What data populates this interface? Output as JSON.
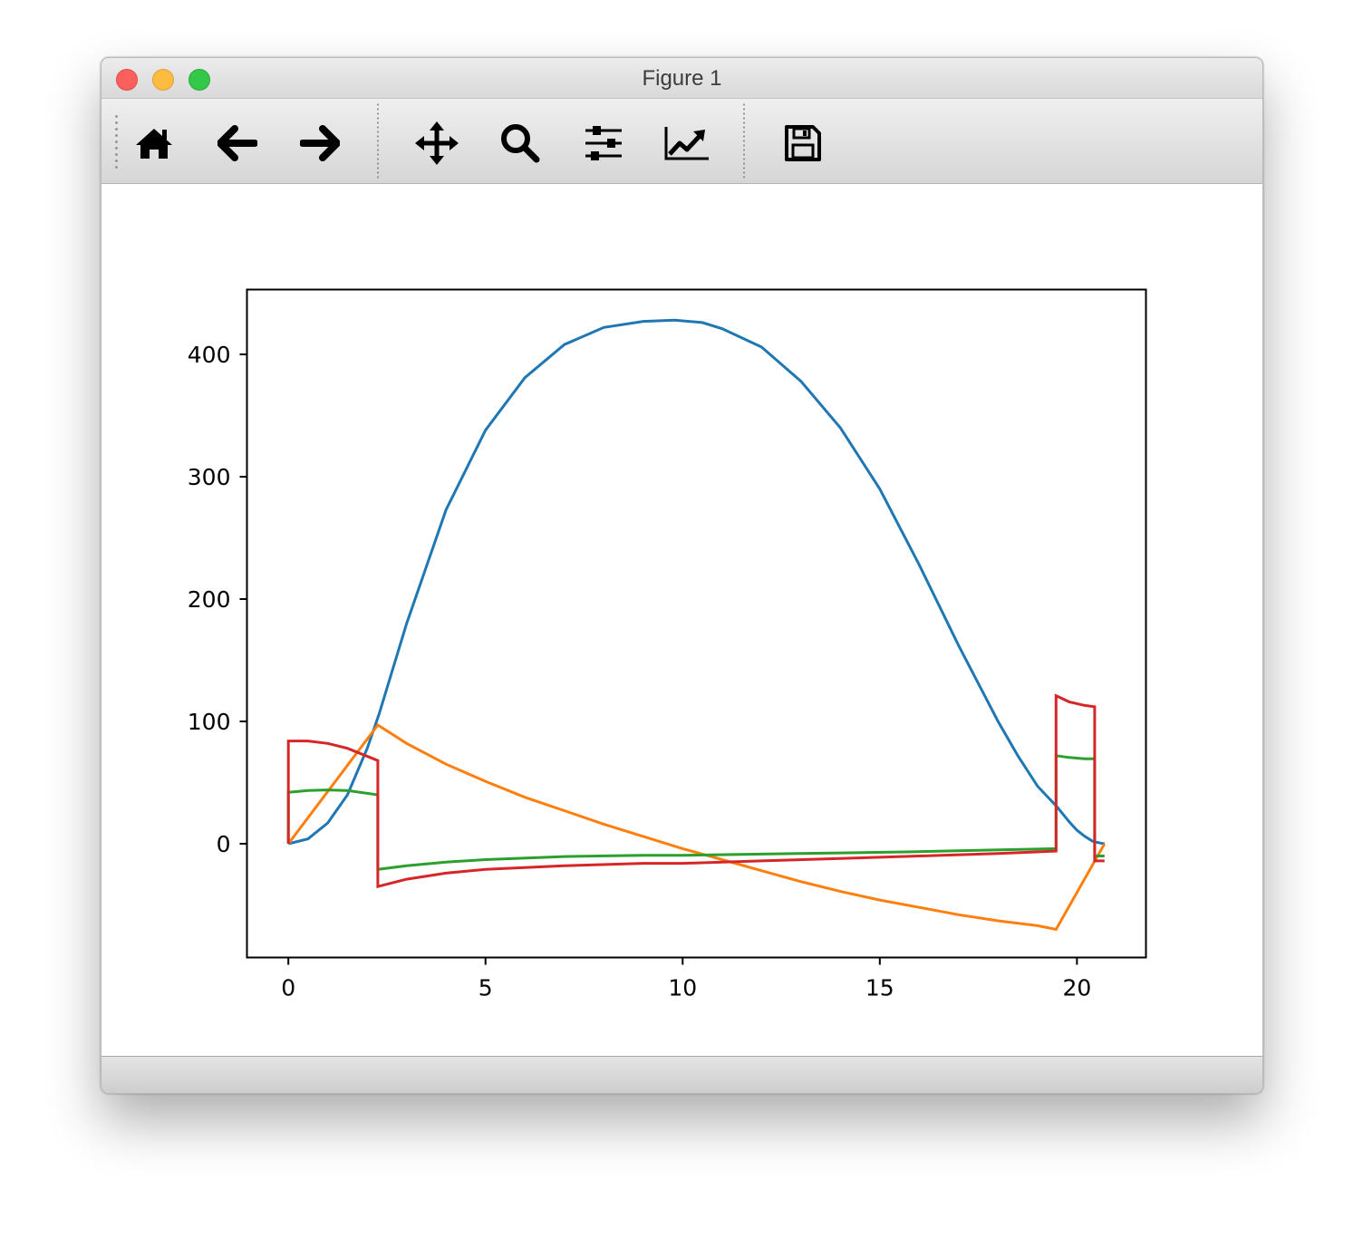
{
  "window": {
    "title": "Figure 1"
  },
  "toolbar": {
    "buttons": [
      {
        "name": "home-button",
        "icon": "home-icon"
      },
      {
        "name": "back-button",
        "icon": "arrow-left-icon"
      },
      {
        "name": "forward-button",
        "icon": "arrow-right-icon"
      },
      {
        "name": "pan-button",
        "icon": "move-arrows-icon"
      },
      {
        "name": "zoom-button",
        "icon": "magnifier-icon"
      },
      {
        "name": "configure-subplots-button",
        "icon": "sliders-icon"
      },
      {
        "name": "edit-axes-button",
        "icon": "line-chart-icon"
      },
      {
        "name": "save-button",
        "icon": "floppy-disk-icon"
      }
    ]
  },
  "chart_data": {
    "type": "line",
    "title": "",
    "xlabel": "",
    "ylabel": "",
    "xlim": [
      -1.05,
      21.75
    ],
    "ylim": [
      -93,
      453
    ],
    "xticks": [
      0,
      5,
      10,
      15,
      20
    ],
    "yticks": [
      0,
      100,
      200,
      300,
      400
    ],
    "grid": false,
    "legend": "none",
    "series": [
      {
        "color": "#1f77b4",
        "x": [
          0,
          0.5,
          1,
          1.5,
          2,
          2.3,
          3,
          4,
          5,
          6,
          7,
          8,
          9,
          9.8,
          10.5,
          11,
          12,
          13,
          14,
          15,
          16,
          17,
          18,
          18.5,
          19,
          19.5,
          19.8,
          20,
          20.2,
          20.4,
          20.6,
          20.7
        ],
        "y": [
          0,
          4,
          17,
          40,
          78,
          106,
          180,
          273,
          338,
          381,
          408,
          422,
          427,
          428,
          426,
          421,
          406,
          378,
          340,
          290,
          228,
          162,
          100,
          72,
          47,
          30,
          18,
          11,
          6,
          2,
          0.5,
          0
        ]
      },
      {
        "color": "#ff7f0e",
        "x": [
          0,
          2.27,
          3,
          4,
          5,
          6,
          7,
          8,
          9,
          10,
          11,
          12,
          13,
          14,
          15,
          16,
          17,
          18,
          19,
          19.47,
          20.7
        ],
        "y": [
          0,
          97,
          82,
          65,
          51,
          38,
          27,
          16,
          6,
          -4,
          -13,
          -22,
          -31,
          -39,
          -46,
          -52,
          -58,
          -63,
          -67,
          -70,
          0
        ]
      },
      {
        "color": "#2ca02c",
        "x": [
          0,
          0,
          0.5,
          1,
          1.5,
          2.27,
          2.27,
          3,
          4,
          5,
          7,
          9,
          10,
          12,
          14,
          16,
          18,
          19.47,
          19.47,
          19.8,
          20.2,
          20.45,
          20.45,
          20.7
        ],
        "y": [
          0,
          42,
          43.5,
          44,
          43.5,
          40,
          -21,
          -18,
          -15,
          -13,
          -10.5,
          -9.5,
          -9.5,
          -8.5,
          -7.5,
          -6.5,
          -5,
          -4,
          72,
          70.5,
          69.5,
          69.5,
          -10,
          -10
        ]
      },
      {
        "color": "#d62728",
        "x": [
          0,
          0,
          0.5,
          1,
          1.5,
          2.27,
          2.27,
          3,
          4,
          5,
          7,
          9,
          10,
          12,
          14,
          16,
          18,
          19.47,
          19.47,
          19.8,
          20.2,
          20.45,
          20.45,
          20.7
        ],
        "y": [
          0,
          84,
          84,
          82,
          78,
          68,
          -35,
          -29,
          -24,
          -21,
          -18,
          -16,
          -16,
          -14,
          -12,
          -10,
          -8,
          -6,
          121,
          116,
          113,
          112,
          -14,
          -14
        ]
      }
    ]
  }
}
